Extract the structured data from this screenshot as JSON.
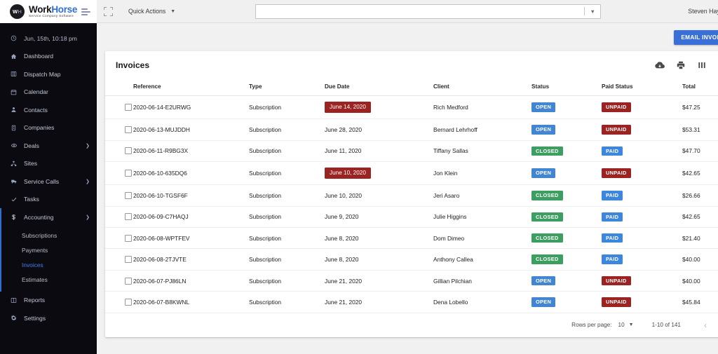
{
  "brand": {
    "logo_initials_1": "W",
    "logo_initials_2": "H",
    "name_part1": "Work",
    "name_part2": "Horse",
    "tagline": "Service Company Software",
    "accent_color": "#2f6fd0"
  },
  "sidebar": {
    "timestamp": "Jun, 15th, 10:18 pm",
    "items": [
      {
        "label": "Dashboard",
        "icon": "home-icon",
        "expandable": false
      },
      {
        "label": "Dispatch Map",
        "icon": "map-icon",
        "expandable": false
      },
      {
        "label": "Calendar",
        "icon": "calendar-icon",
        "expandable": false
      },
      {
        "label": "Contacts",
        "icon": "person-icon",
        "expandable": false
      },
      {
        "label": "Companies",
        "icon": "building-icon",
        "expandable": false
      },
      {
        "label": "Deals",
        "icon": "deal-icon",
        "expandable": true
      },
      {
        "label": "Sites",
        "icon": "sitemap-icon",
        "expandable": false
      },
      {
        "label": "Service Calls",
        "icon": "truck-icon",
        "expandable": true
      },
      {
        "label": "Tasks",
        "icon": "check-icon",
        "expandable": false
      }
    ],
    "accounting": {
      "label": "Accounting",
      "icon": "dollar-icon",
      "expanded": true,
      "sub_items": [
        {
          "label": "Subscriptions",
          "active": false
        },
        {
          "label": "Payments",
          "active": false
        },
        {
          "label": "Invoices",
          "active": true
        },
        {
          "label": "Estimates",
          "active": false
        }
      ]
    },
    "bottom_items": [
      {
        "label": "Reports",
        "icon": "reports-icon"
      },
      {
        "label": "Settings",
        "icon": "gear-icon"
      }
    ]
  },
  "topbar": {
    "expand_icon": "fullscreen-icon",
    "quick_actions_label": "Quick Actions",
    "search_value": "",
    "search_placeholder": "",
    "user_name": "Steven Hayes"
  },
  "actions": {
    "email_invoices_label": "EMAIL INVOICES"
  },
  "card": {
    "title": "Invoices",
    "tools": [
      {
        "name": "cloud-download-icon"
      },
      {
        "name": "print-icon"
      },
      {
        "name": "view-columns-icon"
      },
      {
        "name": "filter-list-icon"
      }
    ]
  },
  "table": {
    "columns": [
      "Reference",
      "Type",
      "Due Date",
      "Client",
      "Status",
      "Paid Status",
      "Total"
    ],
    "rows": [
      {
        "reference": "2020-06-14-E2URWG",
        "type": "Subscription",
        "due_date": "June 14, 2020",
        "due_overdue": true,
        "client": "Rich Medford",
        "status": "OPEN",
        "paid_status": "UNPAID",
        "total": "$47.25"
      },
      {
        "reference": "2020-06-13-MUJDDH",
        "type": "Subscription",
        "due_date": "June 28, 2020",
        "due_overdue": false,
        "client": "Bernard Lehrhoff",
        "status": "OPEN",
        "paid_status": "UNPAID",
        "total": "$53.31"
      },
      {
        "reference": "2020-06-11-R9BG3X",
        "type": "Subscription",
        "due_date": "June 11, 2020",
        "due_overdue": false,
        "client": "Tiffany Sallas",
        "status": "CLOSED",
        "paid_status": "PAID",
        "total": "$47.70"
      },
      {
        "reference": "2020-06-10-635DQ6",
        "type": "Subscription",
        "due_date": "June 10, 2020",
        "due_overdue": true,
        "client": "Jon Klein",
        "status": "OPEN",
        "paid_status": "UNPAID",
        "total": "$42.65"
      },
      {
        "reference": "2020-06-10-TGSF6F",
        "type": "Subscription",
        "due_date": "June 10, 2020",
        "due_overdue": false,
        "client": "Jeri Asaro",
        "status": "CLOSED",
        "paid_status": "PAID",
        "total": "$26.66"
      },
      {
        "reference": "2020-06-09-C7HAQJ",
        "type": "Subscription",
        "due_date": "June 9, 2020",
        "due_overdue": false,
        "client": "Julie Higgins",
        "status": "CLOSED",
        "paid_status": "PAID",
        "total": "$42.65"
      },
      {
        "reference": "2020-06-08-WPTFEV",
        "type": "Subscription",
        "due_date": "June 8, 2020",
        "due_overdue": false,
        "client": "Dom Dimeo",
        "status": "CLOSED",
        "paid_status": "PAID",
        "total": "$21.40"
      },
      {
        "reference": "2020-06-08-2TJVTE",
        "type": "Subscription",
        "due_date": "June 8, 2020",
        "due_overdue": false,
        "client": "Anthony Callea",
        "status": "CLOSED",
        "paid_status": "PAID",
        "total": "$40.00"
      },
      {
        "reference": "2020-06-07-PJ86LN",
        "type": "Subscription",
        "due_date": "June 21, 2020",
        "due_overdue": false,
        "client": "Gillian Pilchian",
        "status": "OPEN",
        "paid_status": "UNPAID",
        "total": "$40.00"
      },
      {
        "reference": "2020-06-07-B8KWNL",
        "type": "Subscription",
        "due_date": "June 21, 2020",
        "due_overdue": false,
        "client": "Dena Lobello",
        "status": "OPEN",
        "paid_status": "UNPAID",
        "total": "$45.84"
      }
    ]
  },
  "pagination": {
    "rows_per_page_label": "Rows per page:",
    "rows_per_page_value": "10",
    "range_label": "1-10 of 141",
    "prev_enabled": false,
    "next_enabled": true
  },
  "colors": {
    "open": "#4285d0",
    "closed": "#3c9e60",
    "unpaid": "#9b2423",
    "paid": "#3d86dd",
    "overdue": "#9b2423",
    "primary_button": "#3a6fd8",
    "sidebar_bg": "#0a0a10"
  }
}
